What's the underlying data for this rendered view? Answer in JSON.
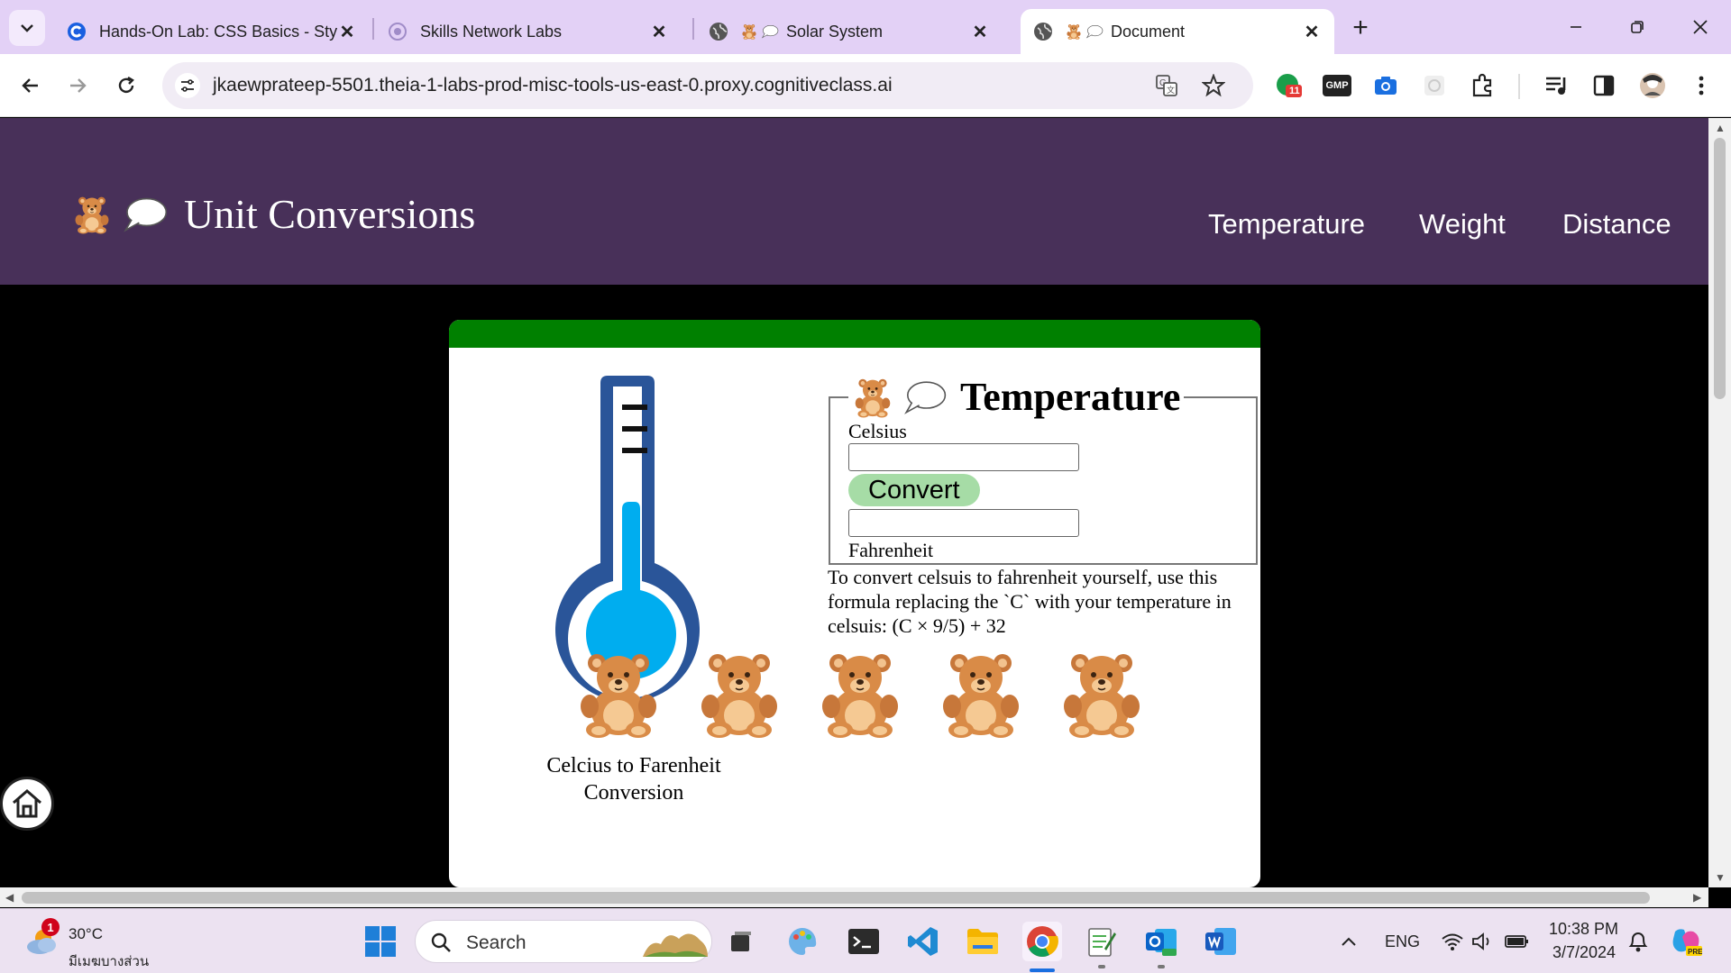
{
  "browser": {
    "tabs": [
      {
        "title": "Hands-On Lab: CSS Basics - Styl",
        "active": false
      },
      {
        "title": "Skills Network Labs",
        "active": false
      },
      {
        "title": "Solar System",
        "active": false
      },
      {
        "title": "Document",
        "active": true
      }
    ],
    "url": "jkaewprateep-5501.theia-1-labs-prod-misc-tools-us-east-0.proxy.cognitiveclass.ai",
    "extension_badge": "11",
    "extension_gmp_label": "GMP"
  },
  "site": {
    "brand_title": "Unit Conversions",
    "nav": [
      "Temperature",
      "Weight",
      "Distance"
    ],
    "header_color": "#483059",
    "band_color": "#008000"
  },
  "converter": {
    "legend": "Temperature",
    "input_label": "Celsius",
    "celsius_value": "",
    "button_label": "Convert",
    "output_value": "",
    "output_label": "Fahrenheit",
    "formula_text": "To convert celsuis to fahrenheit yourself, use this formula replacing the `C` with your temperature in celsuis: (C × 9/5) + 32",
    "image_caption": "Celcius to Farenheit Conversion",
    "bear_count": 5
  },
  "taskbar": {
    "weather_temp": "30°C",
    "weather_condition": "มีเมฆบางส่วน",
    "weather_badge": "1",
    "search_placeholder": "Search",
    "language": "ENG",
    "time": "10:38 PM",
    "date": "3/7/2024"
  }
}
